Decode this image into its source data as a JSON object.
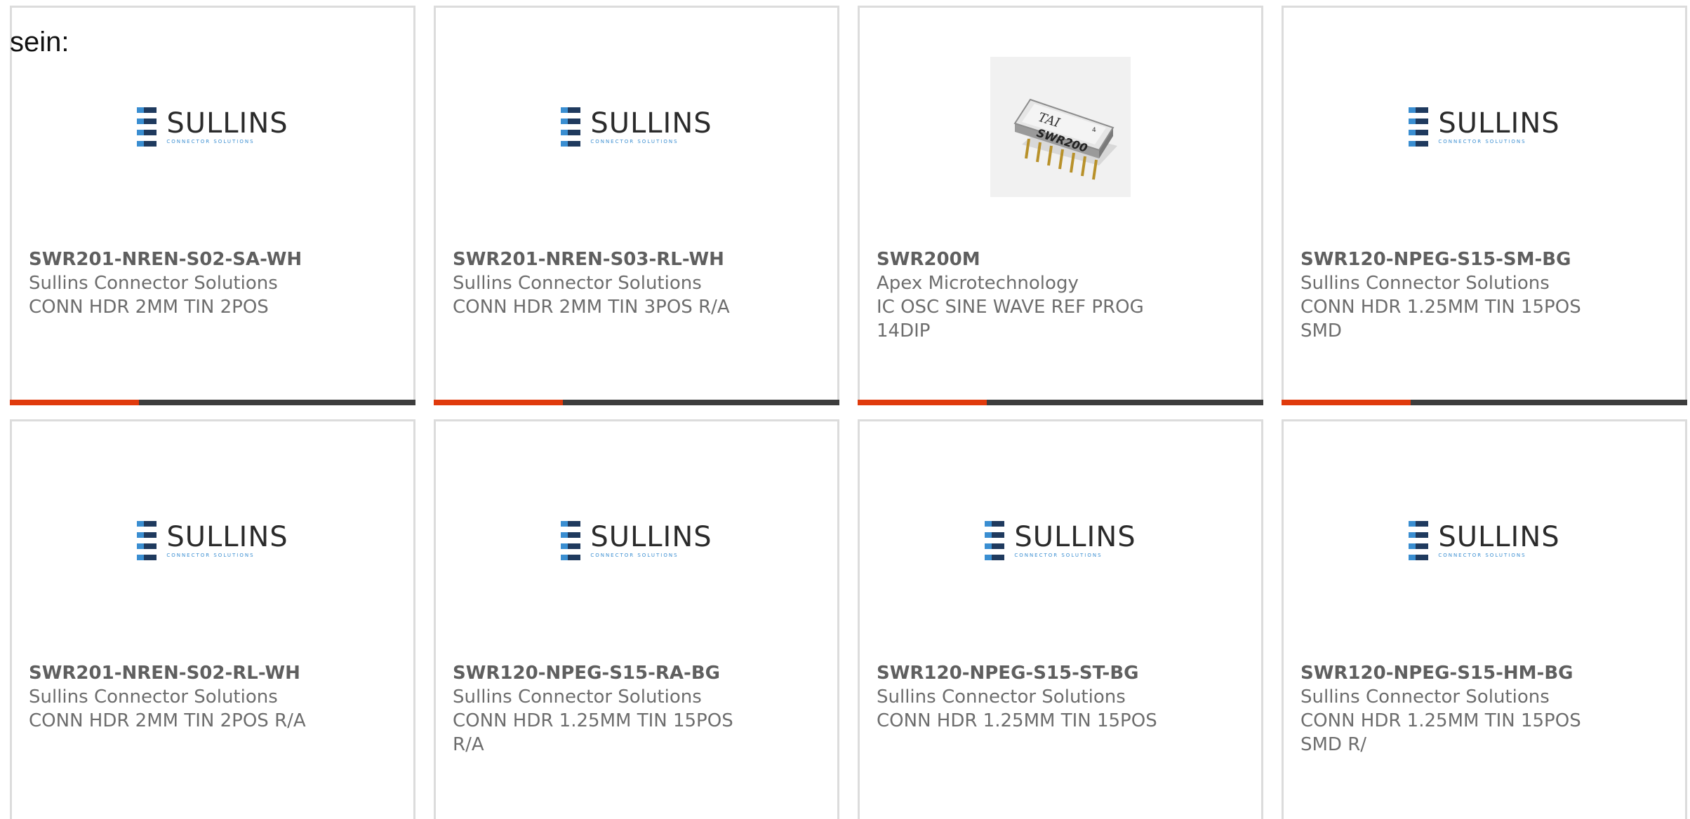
{
  "intro_text": "sein:",
  "colors": {
    "accent": "#e03a0c",
    "bar": "#3d3d3d",
    "border": "#dcdcdc",
    "text": "#6d6d6d"
  },
  "logos": {
    "sullins": {
      "name": "SULLINS",
      "tagline": "CONNECTOR SOLUTIONS"
    },
    "chip": {
      "brand": "TAI",
      "label": "SWR200",
      "pin_mark": "4"
    }
  },
  "cards": [
    {
      "part_number": "SWR201-NREN-S02-SA-WH",
      "manufacturer": "Sullins Connector Solutions",
      "description": "CONN HDR 2MM TIN 2POS",
      "image": "sullins-logo"
    },
    {
      "part_number": "SWR201-NREN-S03-RL-WH",
      "manufacturer": "Sullins Connector Solutions",
      "description": "CONN HDR 2MM TIN 3POS R/A",
      "image": "sullins-logo"
    },
    {
      "part_number": "SWR200M",
      "manufacturer": "Apex Microtechnology",
      "description": "IC OSC SINE WAVE REF PROG 14DIP",
      "image": "chip-photo"
    },
    {
      "part_number": "SWR120-NPEG-S15-SM-BG",
      "manufacturer": "Sullins Connector Solutions",
      "description": "CONN HDR 1.25MM TIN 15POS SMD",
      "image": "sullins-logo"
    },
    {
      "part_number": "SWR201-NREN-S02-RL-WH",
      "manufacturer": "Sullins Connector Solutions",
      "description": "CONN HDR 2MM TIN 2POS R/A",
      "image": "sullins-logo"
    },
    {
      "part_number": "SWR120-NPEG-S15-RA-BG",
      "manufacturer": "Sullins Connector Solutions",
      "description": "CONN HDR 1.25MM TIN 15POS R/A",
      "image": "sullins-logo"
    },
    {
      "part_number": "SWR120-NPEG-S15-ST-BG",
      "manufacturer": "Sullins Connector Solutions",
      "description": "CONN HDR 1.25MM TIN 15POS",
      "image": "sullins-logo"
    },
    {
      "part_number": "SWR120-NPEG-S15-HM-BG",
      "manufacturer": "Sullins Connector Solutions",
      "description": "CONN HDR 1.25MM TIN 15POS SMD R/",
      "image": "sullins-logo"
    }
  ]
}
